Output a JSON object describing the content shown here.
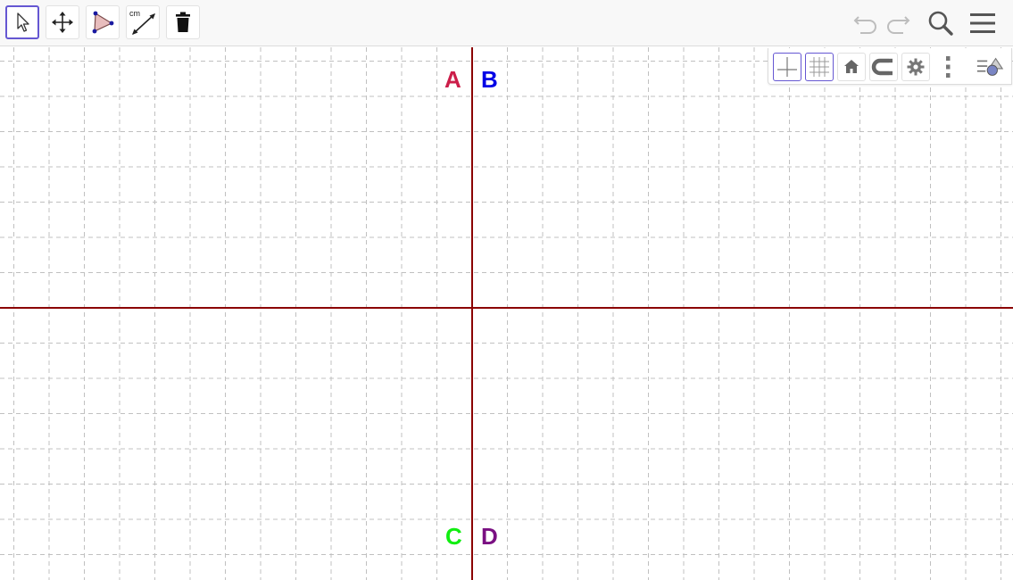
{
  "toolbar": {
    "tools": [
      {
        "name": "move-tool",
        "icon": "arrow-pointer-icon",
        "selected": true
      },
      {
        "name": "move-graphics-view-tool",
        "icon": "move-arrows-icon",
        "selected": false
      },
      {
        "name": "polygon-tool",
        "icon": "triangle-icon",
        "selected": false
      },
      {
        "name": "distance-tool",
        "icon": "ruler-distance-icon",
        "label": "cm",
        "selected": false
      },
      {
        "name": "delete-tool",
        "icon": "trash-icon",
        "selected": false
      }
    ],
    "right_buttons": [
      "undo-icon",
      "redo-icon",
      "search-icon",
      "hamburger-menu-icon"
    ]
  },
  "stylebar": {
    "buttons": [
      "axes-icon",
      "grid-icon",
      "home-icon",
      "magnet-icon",
      "gear-icon",
      "more-vertical-icon",
      "algebra-view-icon"
    ],
    "axes_active": true,
    "grid_active": true
  },
  "graphics": {
    "points": [
      {
        "label": "A",
        "color": "#cc1e4a"
      },
      {
        "label": "B",
        "color": "#0000e6"
      },
      {
        "label": "C",
        "color": "#11ee11"
      },
      {
        "label": "D",
        "color": "#7a1082"
      }
    ],
    "axis_color": "#8b0000",
    "grid_color": "#c0c0c0",
    "grid_style": "dashed"
  }
}
